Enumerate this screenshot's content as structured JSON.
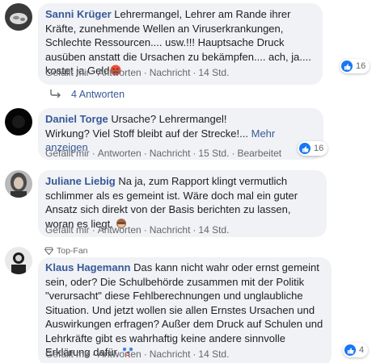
{
  "comments": [
    {
      "author": "Sanni Krüger",
      "text": "Lehrermangel, Lehrer am Rande ihrer Kräfte, zunehmende Wellen an Viruserkrankungen, Schlechte Ressourcen.... usw.!!! Hauptsache Druck ausüben anstatt die Ursachen zu bekämpfen.... ach, ja.... kostet ja Geld",
      "emoji": "angry-face-icon",
      "actions": {
        "like": "Gefällt mir",
        "reply": "Antworten",
        "message": "Nachricht",
        "time": "14 Std."
      },
      "reactions": "16",
      "replies": "4 Antworten"
    },
    {
      "author": "Daniel Torge",
      "line1": "Ursache? Lehrermangel!",
      "line2": "Wirkung? Viel Stoff bleibt auf der Strecke!...",
      "more": "Mehr anzeigen",
      "actions": {
        "like": "Gefällt mir",
        "reply": "Antworten",
        "message": "Nachricht",
        "time": "15 Std.",
        "edited": "Bearbeitet"
      },
      "reactions": "16"
    },
    {
      "author": "Juliane Liebig",
      "text": "Na ja, zum Rapport klingt vermutlich schlimmer als es gemeint ist. Wäre doch mal ein guter Ansatz sich direkt von der Basis berichten zu lassen, woran es liegt.",
      "emoji": "see-no-evil-monkey-icon",
      "actions": {
        "like": "Gefällt mir",
        "reply": "Antworten",
        "message": "Nachricht",
        "time": "14 Std."
      }
    },
    {
      "badge": "Top-Fan",
      "author": "Klaus Hagemann",
      "text": "Das kann nicht wahr oder ernst gemeint sein, oder? Die Schulbehörde zusammen mit der Politik \"verursacht\" diese Fehlberechnungen und unglaubliche Situation. Und jetzt wollen sie allen Ernstes Ursachen und Auswirkungen erfragen? Außer dem Druck auf Schulen und Lehrkräfte gibt es wahrhaftig keine andere sinnvolle Erklärung dafür.",
      "emoji": "clown-face-icon",
      "actions": {
        "like": "Gefällt mir",
        "reply": "Antworten",
        "message": "Nachricht",
        "time": "14 Std."
      },
      "reactions": "4"
    }
  ]
}
